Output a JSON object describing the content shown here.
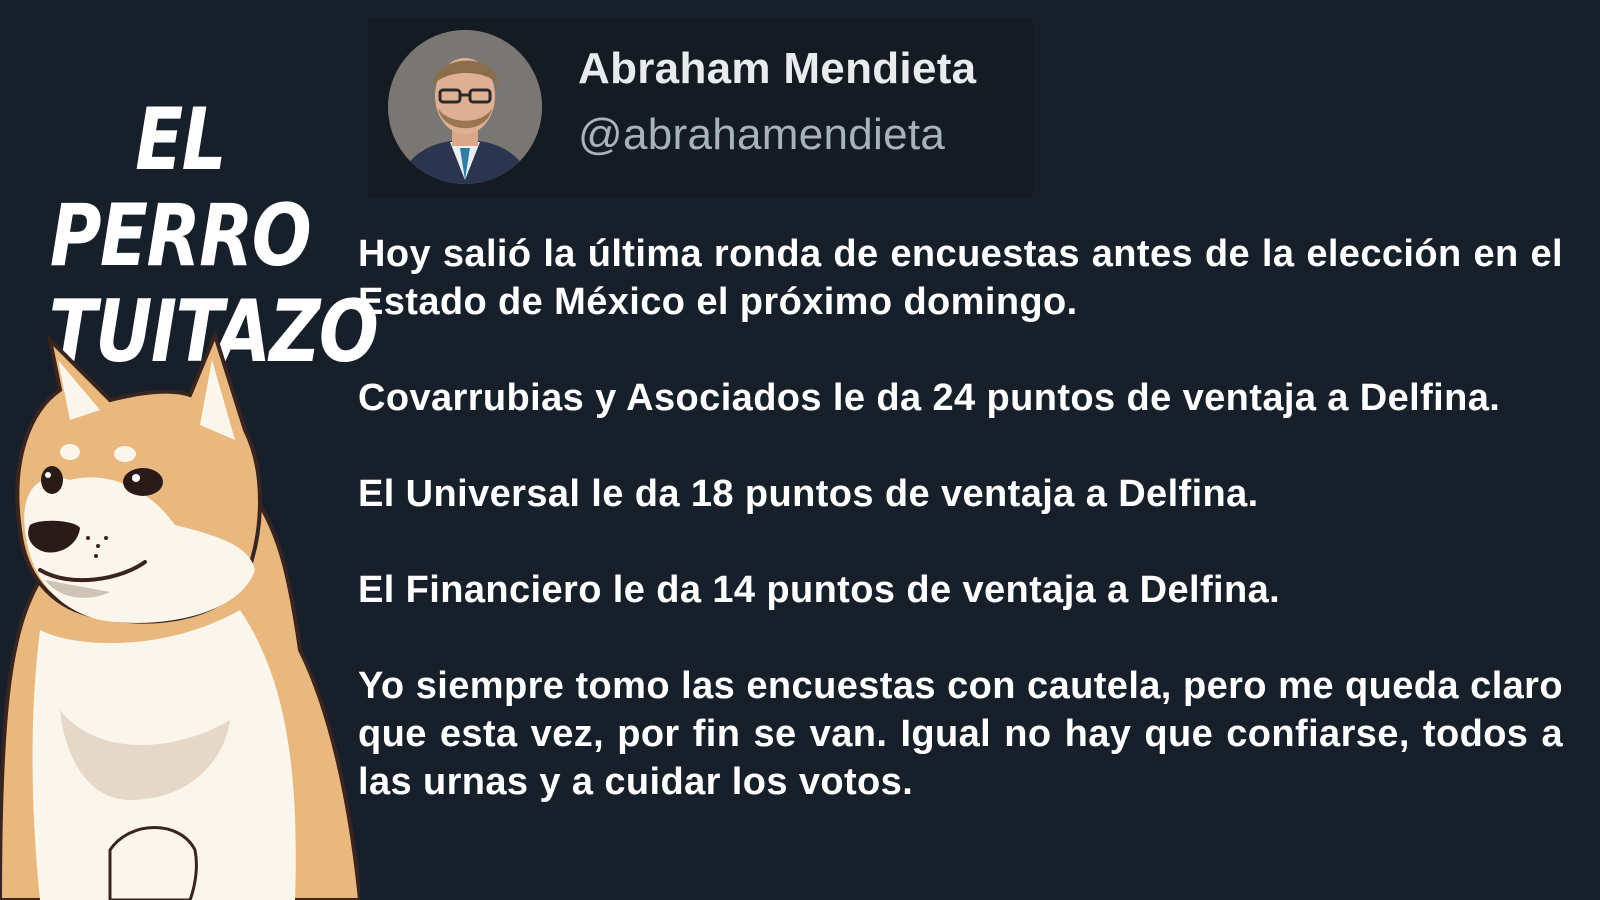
{
  "brand": {
    "line1": "EL PERRO",
    "line2": "TUITAZO"
  },
  "mascot": {
    "icon": "shiba-inu-doge-illustration"
  },
  "author": {
    "name": "Abraham Mendieta",
    "handle": "@abrahamendieta",
    "avatar_icon": "profile-photo"
  },
  "tweet": {
    "paragraphs": [
      "Hoy salió la última ronda de encuestas antes de la elección en el Estado de México el próximo domingo.",
      "Covarrubias y Asociados le da 24 puntos de ventaja a Delfina.",
      "El Universal le da 18 puntos de ventaja a Delfina.",
      "El Financiero le da 14 puntos de ventaja a Delfina.",
      "Yo siempre tomo las encuestas con cautela, pero me queda claro que esta vez, por fin se van. Igual no hay que confiarse, todos a las urnas y a cuidar los votos."
    ]
  },
  "colors": {
    "background": "#17202a",
    "text": "#ffffff",
    "handle": "#a8b2bd",
    "doge_fur": "#e8b87e",
    "doge_cream": "#fbf6ec"
  }
}
